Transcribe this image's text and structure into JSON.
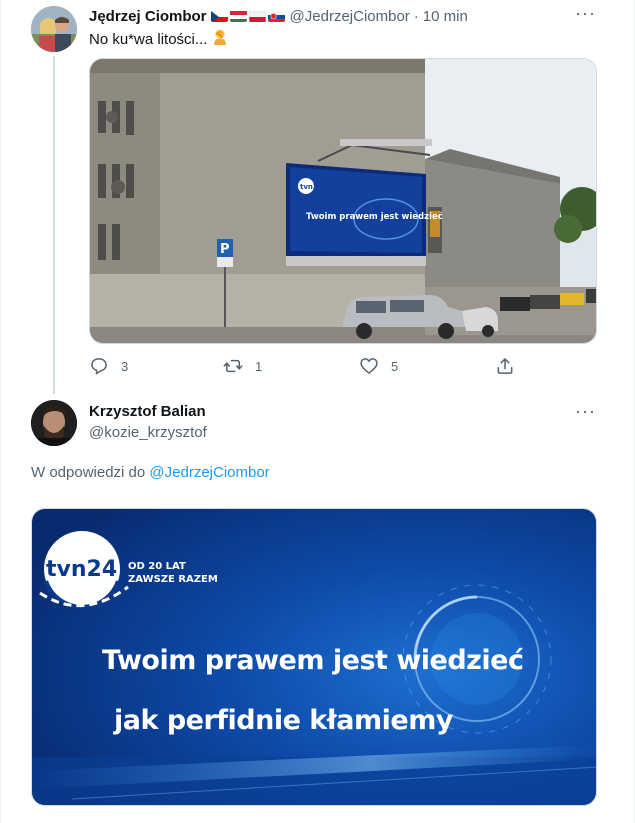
{
  "tweet1": {
    "author_name": "Jędrzej Ciombor",
    "flags": [
      "cz-flag",
      "hu-flag",
      "pl-flag",
      "sk-flag"
    ],
    "handle": "@JedrzejCiombor",
    "separator": "·",
    "time": "10 min",
    "text": "No ku*wa litości...",
    "emoji_icon": "person-facepalm-icon",
    "media": {
      "billboard_line1": "Twoim prawem jest wiedzieć",
      "billboard_logo": "tvn24"
    },
    "actions": {
      "reply_count": "3",
      "retweet_count": "1",
      "like_count": "5"
    }
  },
  "tweet2": {
    "author_name": "Krzysztof Balian",
    "handle": "@kozie_krzysztof",
    "reply_prefix": "W odpowiedzi do",
    "reply_to": "@JedrzejCiombor",
    "media": {
      "logo": "tvn24",
      "tagline1": "OD 20 LAT",
      "tagline2": "ZAWSZE RAZEM",
      "line1": "Twoim prawem jest wiedzieć",
      "line2": "jak perfidnie kłamiemy"
    }
  },
  "colors": {
    "accent": "#1d9bf0",
    "secondary_text": "#536471",
    "border": "#cfd9de",
    "tvn_blue": "#0b3a8c"
  }
}
